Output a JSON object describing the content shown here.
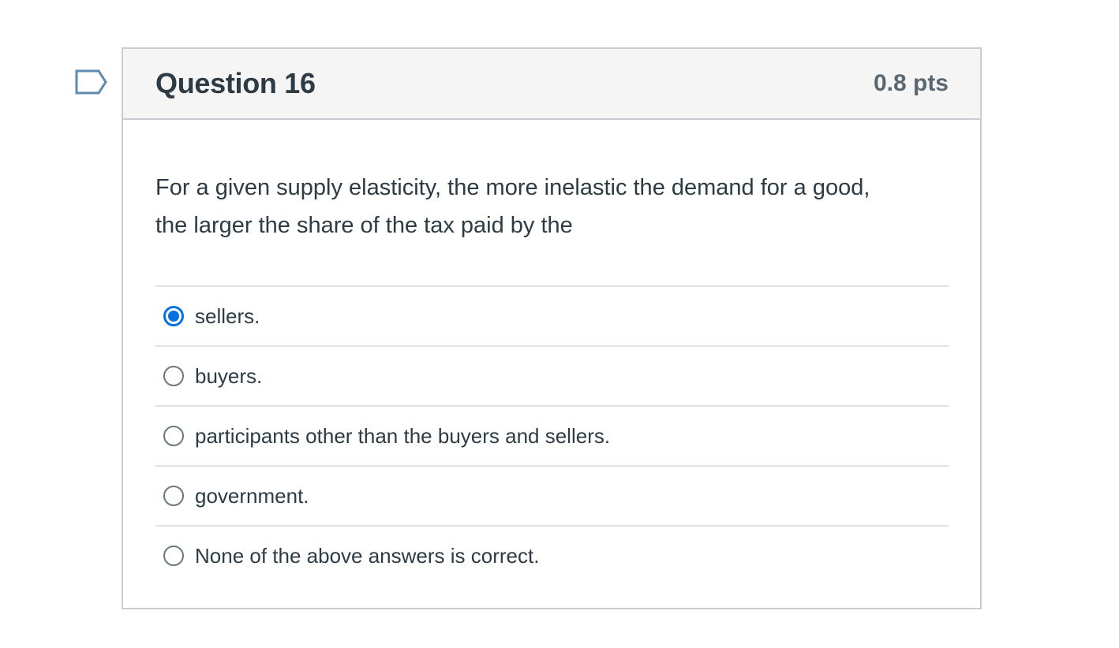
{
  "question": {
    "title": "Question 16",
    "points": "0.8 pts",
    "text_line1": "For a given supply elasticity, the more inelastic the demand for a good,",
    "text_line2": "the larger the share of the tax paid by the",
    "answers": [
      {
        "label": "sellers.",
        "selected": true
      },
      {
        "label": "buyers.",
        "selected": false
      },
      {
        "label": "participants other than the buyers and sellers.",
        "selected": false
      },
      {
        "label": "government.",
        "selected": false
      },
      {
        "label": "None of the above answers is correct.",
        "selected": false
      }
    ]
  },
  "icons": {
    "flag": "flag-question-icon"
  },
  "colors": {
    "accent": "#0770e3",
    "flag_stroke": "#5b8bb0",
    "header_bg": "#f5f5f5",
    "border": "#c7cdd1",
    "text": "#2d3b45"
  }
}
